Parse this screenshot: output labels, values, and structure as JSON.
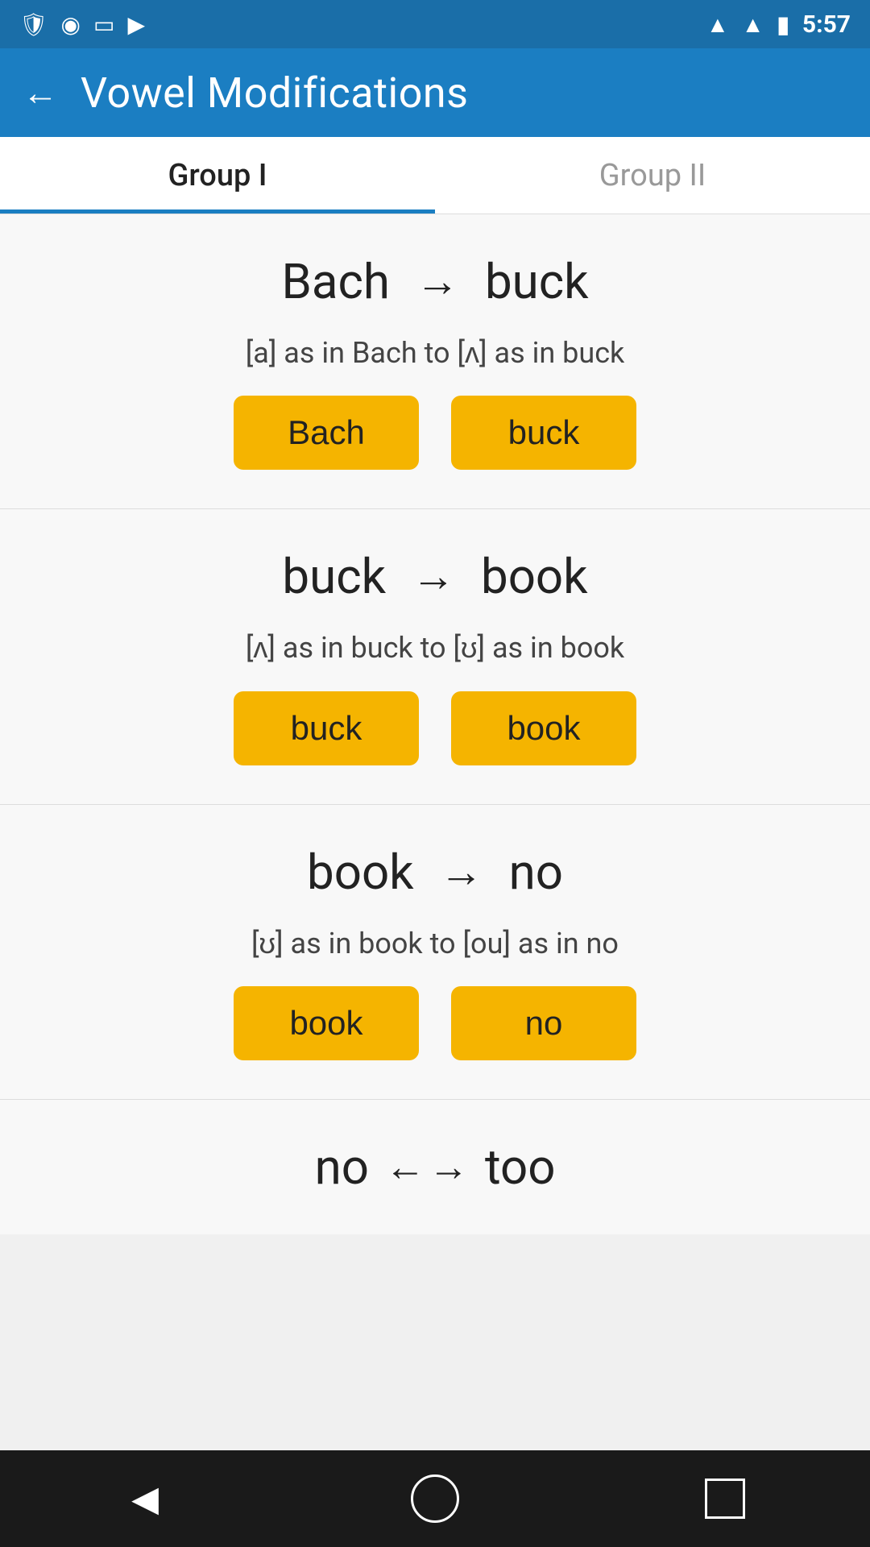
{
  "statusBar": {
    "time": "5:57"
  },
  "appBar": {
    "title": "Vowel Modifications",
    "backLabel": "←"
  },
  "tabs": [
    {
      "id": "group1",
      "label": "Group I",
      "active": true
    },
    {
      "id": "group2",
      "label": "Group II",
      "active": false
    }
  ],
  "cards": [
    {
      "id": "card1",
      "wordFrom": "Bach",
      "wordTo": "buck",
      "arrow": "→",
      "phonetic": "[a] as in Bach to [ʌ] as in buck",
      "btnFrom": "Bach",
      "btnTo": "buck"
    },
    {
      "id": "card2",
      "wordFrom": "buck",
      "wordTo": "book",
      "arrow": "→",
      "phonetic": "[ʌ] as in buck to [ʊ] as in book",
      "btnFrom": "buck",
      "btnTo": "book"
    },
    {
      "id": "card3",
      "wordFrom": "book",
      "wordTo": "no",
      "arrow": "→",
      "phonetic": "[ʊ] as in book to [ou] as in no",
      "btnFrom": "book",
      "btnTo": "no"
    }
  ],
  "lastCard": {
    "wordFrom": "no",
    "wordTo": "too",
    "arrowLeft": "←",
    "arrowRight": "→"
  },
  "navBar": {
    "backLabel": "◀"
  }
}
